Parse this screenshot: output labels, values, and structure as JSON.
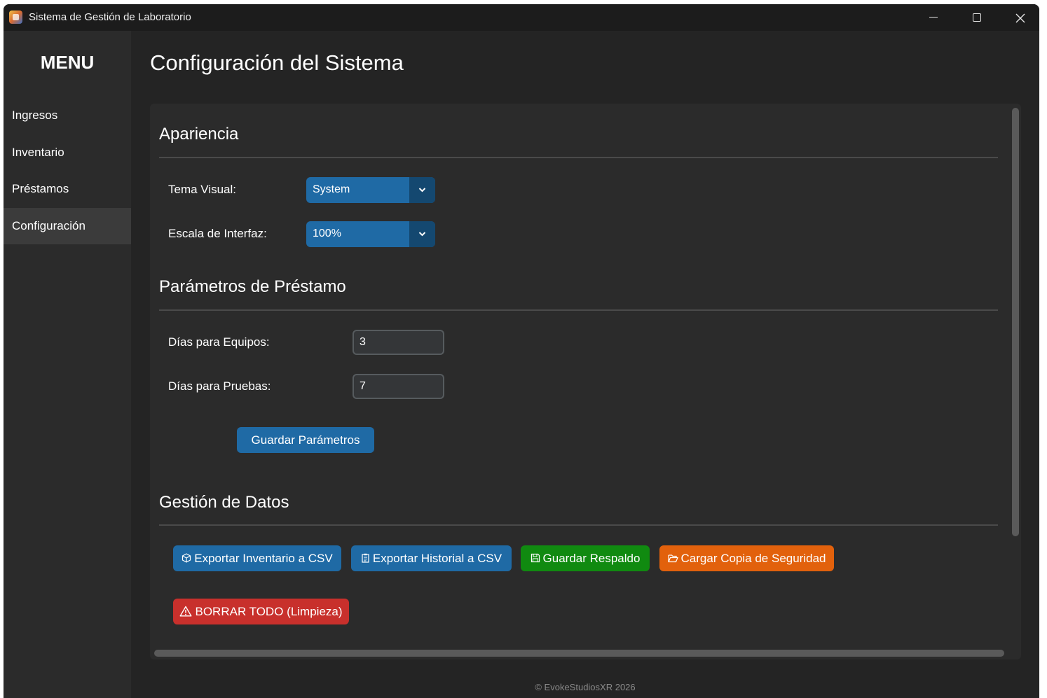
{
  "window": {
    "title": "Sistema de Gestión de Laboratorio"
  },
  "sidebar": {
    "title": "MENU",
    "items": [
      {
        "label": "Ingresos"
      },
      {
        "label": "Inventario"
      },
      {
        "label": "Préstamos"
      },
      {
        "label": "Configuración",
        "active": true
      }
    ]
  },
  "page": {
    "title": "Configuración del Sistema"
  },
  "appearance": {
    "title": "Apariencia",
    "theme_label": "Tema Visual:",
    "theme_value": "System",
    "scale_label": "Escala de Interfaz:",
    "scale_value": "100%"
  },
  "loan_params": {
    "title": "Parámetros de Préstamo",
    "equipment_days_label": "Días para Equipos:",
    "equipment_days_value": "3",
    "tests_days_label": "Días para Pruebas:",
    "tests_days_value": "7",
    "save_button": "Guardar Parámetros"
  },
  "data_management": {
    "title": "Gestión de Datos",
    "export_inventory": "Exportar Inventario a CSV",
    "export_history": "Exportar Historial a CSV",
    "save_backup": "Guardar Respaldo",
    "load_backup": "Cargar Copia de Seguridad",
    "delete_all": "BORRAR TODO (Limpieza)"
  },
  "footer": {
    "text": "© EvokeStudiosXR 2026"
  },
  "colors": {
    "accent_blue": "#1f6aa5",
    "success_green": "#108a10",
    "warning_orange": "#e2610c",
    "danger_red": "#c8302c"
  },
  "icons": {
    "export_inventory": "package-icon",
    "export_history": "clipboard-icon",
    "save_backup": "floppy-disk-icon",
    "load_backup": "folder-open-icon",
    "delete_all": "warning-icon"
  }
}
